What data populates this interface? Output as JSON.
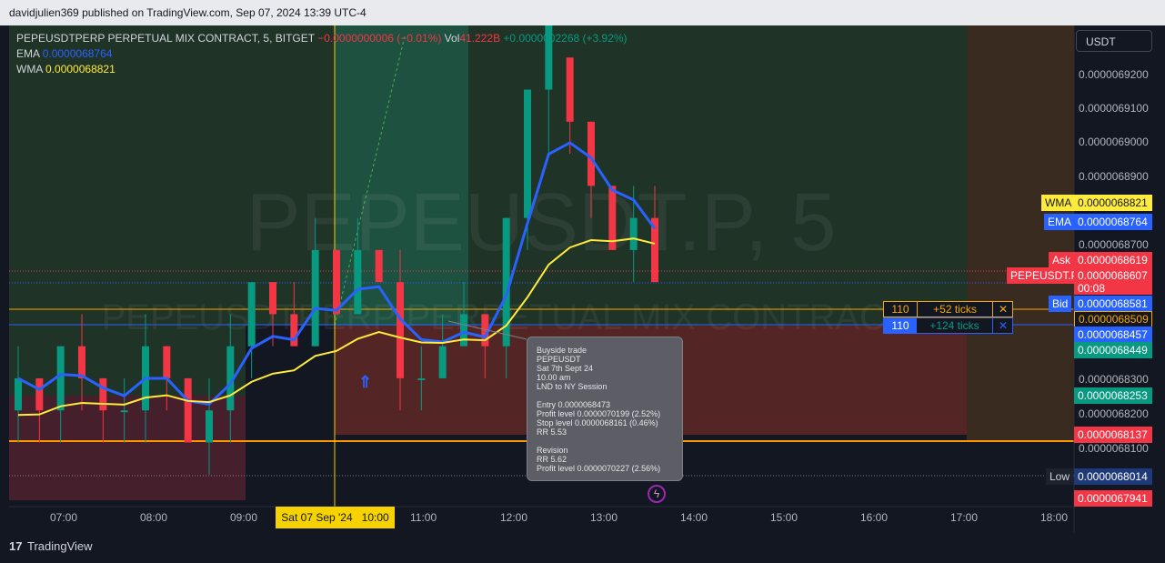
{
  "header": {
    "published": "davidjulien369 published on TradingView.com, Sep 07, 2024 13:39 UTC-4"
  },
  "legend": {
    "symbol": "PEPEUSDTPERP PERPETUAL MIX CONTRACT, 5, BITGET",
    "change": "−0.0000000006 (−0.01%)",
    "vol_label": "Vol",
    "vol_value": "41.222B",
    "vol_change": "+0.0000002268 (+3.92%)",
    "ema_label": "EMA",
    "ema_value": "0.0000068764",
    "wma_label": "WMA",
    "wma_value": "0.0000068821"
  },
  "currency": "USDT",
  "watermark": {
    "line1": "PEPEUSDT.P, 5",
    "line2": "PEPEUSDTPERP PERPETUAL MIX CONTRACT"
  },
  "price_scale": {
    "ticks": [
      "0.0000069200",
      "0.0000069100",
      "0.0000069000",
      "0.0000068900",
      "0.0000068700",
      "0.0000068300",
      "0.0000068200",
      "0.0000068100"
    ]
  },
  "price_tags": {
    "wma_label": "WMA",
    "wma_value": "0.0000068821",
    "ema_label": "EMA",
    "ema_value": "0.0000068764",
    "ask_label": "Ask",
    "ask_value": "0.0000068619",
    "sym_label": "PEPEUSDT.P",
    "sym_value": "0.0000068607",
    "countdown": "00:08",
    "bid_label": "Bid",
    "bid_value": "0.0000068581",
    "order_long_value": "0.0000068509",
    "order_short_value": "0.0000068457",
    "green1_value": "0.0000068449",
    "green2_value": "0.0000068253",
    "red_value": "0.0000068137",
    "low_label": "Low",
    "low_value": "0.0000068014",
    "bottom_red_value": "0.0000067941"
  },
  "orders": [
    {
      "qty": "110",
      "ticks": "+52 ticks",
      "close": "✕",
      "color": "#f7a600"
    },
    {
      "qty": "110",
      "ticks": "+124 ticks",
      "close": "✕",
      "color": "#2962ff"
    }
  ],
  "time_axis": {
    "labels": [
      "07:00",
      "08:00",
      "09:00",
      "11:00",
      "12:00",
      "13:00",
      "14:00",
      "15:00",
      "16:00",
      "17:00",
      "18:00"
    ],
    "crosshair_date": "Sat 07 Sep '24",
    "crosshair_time": "10:00"
  },
  "tooltip": {
    "lines": [
      "Buyside trade",
      "PEPEUSDT",
      "Sat 7th Sept 24",
      "10.00 am",
      "LND to NY Session",
      "",
      "Entry 0.0000068473",
      "Profit level 0.0000070199 (2.52%)",
      "Stop level 0.0000068161 (0.46%)",
      "RR 5.53",
      "",
      "Revision",
      "RR 5.62",
      "Profit level 0.0000070227 (2.56%)"
    ]
  },
  "footer": {
    "brand": "TradingView"
  },
  "colors": {
    "up": "#089981",
    "down": "#f23645",
    "ema": "#2962ff",
    "wma": "#ffeb3b",
    "accent": "#f7a600"
  },
  "chart_data": {
    "type": "candlestick",
    "title": "PEPEUSDTPERP PERPETUAL MIX CONTRACT, 5, BITGET",
    "xlabel": "",
    "ylabel": "",
    "ylim": [
      6.79e-06,
      6.94e-06
    ],
    "series": [
      {
        "name": "EMA",
        "values": [
          6.8764e-06
        ]
      },
      {
        "name": "WMA",
        "values": [
          6.8821e-06
        ]
      }
    ],
    "ohlc": [
      [
        6.82e-06,
        6.84e-06,
        6.81e-06,
        6.83e-06
      ],
      [
        6.83e-06,
        6.83e-06,
        6.81e-06,
        6.82e-06
      ],
      [
        6.82e-06,
        6.84e-06,
        6.81e-06,
        6.84e-06
      ],
      [
        6.84e-06,
        6.85e-06,
        6.82e-06,
        6.83e-06
      ],
      [
        6.83e-06,
        6.83e-06,
        6.81e-06,
        6.82e-06
      ],
      [
        6.82e-06,
        6.83e-06,
        6.81e-06,
        6.82e-06
      ],
      [
        6.82e-06,
        6.85e-06,
        6.81e-06,
        6.84e-06
      ],
      [
        6.84e-06,
        6.84e-06,
        6.82e-06,
        6.83e-06
      ],
      [
        6.83e-06,
        6.83e-06,
        6.81e-06,
        6.81e-06
      ],
      [
        6.81e-06,
        6.83e-06,
        6.8e-06,
        6.82e-06
      ],
      [
        6.82e-06,
        6.85e-06,
        6.81e-06,
        6.84e-06
      ],
      [
        6.84e-06,
        6.86e-06,
        6.83e-06,
        6.86e-06
      ],
      [
        6.86e-06,
        6.86e-06,
        6.84e-06,
        6.85e-06
      ],
      [
        6.85e-06,
        6.86e-06,
        6.84e-06,
        6.84e-06
      ],
      [
        6.84e-06,
        6.88e-06,
        6.84e-06,
        6.87e-06
      ],
      [
        6.87e-06,
        6.87e-06,
        6.85e-06,
        6.85e-06
      ],
      [
        6.85e-06,
        6.88e-06,
        6.85e-06,
        6.87e-06
      ],
      [
        6.87e-06,
        6.87e-06,
        6.86e-06,
        6.86e-06
      ],
      [
        6.86e-06,
        6.87e-06,
        6.82e-06,
        6.83e-06
      ],
      [
        6.83e-06,
        6.84e-06,
        6.82e-06,
        6.83e-06
      ],
      [
        6.83e-06,
        6.85e-06,
        6.83e-06,
        6.84e-06
      ],
      [
        6.84e-06,
        6.86e-06,
        6.84e-06,
        6.85e-06
      ],
      [
        6.85e-06,
        6.85e-06,
        6.83e-06,
        6.84e-06
      ],
      [
        6.84e-06,
        6.88e-06,
        6.83e-06,
        6.88e-06
      ],
      [
        6.88e-06,
        6.92e-06,
        6.87e-06,
        6.92e-06
      ],
      [
        6.92e-06,
        6.94e-06,
        6.9e-06,
        6.94e-06
      ],
      [
        6.93e-06,
        6.93e-06,
        6.9e-06,
        6.91e-06
      ],
      [
        6.91e-06,
        6.91e-06,
        6.88e-06,
        6.89e-06
      ],
      [
        6.89e-06,
        6.89e-06,
        6.87e-06,
        6.87e-06
      ],
      [
        6.87e-06,
        6.89e-06,
        6.86e-06,
        6.88e-06
      ],
      [
        6.88e-06,
        6.89e-06,
        6.86e-06,
        6.86e-06
      ]
    ]
  }
}
